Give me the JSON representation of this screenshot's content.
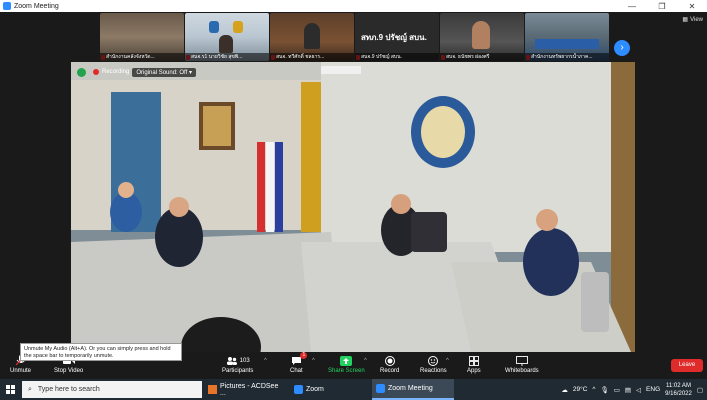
{
  "window": {
    "title": "Zoom Meeting",
    "view_label": "View"
  },
  "thumbnails": [
    {
      "label": "สำนักงานคลังจังหวัด..."
    },
    {
      "label": "สนจ.ร1 นายวิชัย สุขพิ..."
    },
    {
      "label": "สนจ. ทวีศักดิ์ ชลธาร..."
    },
    {
      "label": "สนจ.9 ปรัชญ์ สบน.",
      "big_name": "สทภ.9 ปรัชญ์ สบน."
    },
    {
      "label": "สบจ. ธนัชพร ผ่องศรี"
    },
    {
      "label": "สำนักงานทรัพยากรน้ำภาค..."
    }
  ],
  "recording": {
    "label": "Recording",
    "sound_label": "Original Sound: Off"
  },
  "tooltip": {
    "text": "Unmute My Audio (Alt+A). Or you can simply press and hold the space bar to temporarily unmute."
  },
  "toolbar": {
    "unmute_label": "Unmute",
    "stop_video_label": "Stop Video",
    "participants_label": "Participants",
    "participants_count": "103",
    "chat_label": "Chat",
    "chat_badge": "1",
    "share_label": "Share Screen",
    "record_label": "Record",
    "reactions_label": "Reactions",
    "apps_label": "Apps",
    "whiteboards_label": "Whiteboards",
    "leave_label": "Leave"
  },
  "taskbar": {
    "search_placeholder": "Type here to search",
    "tasks": [
      {
        "label": "Pictures - ACDSee ..."
      },
      {
        "label": "Zoom"
      },
      {
        "label": "Zoom Meeting"
      }
    ],
    "weather": "29°C",
    "language": "ENG",
    "time": "11:02 AM",
    "date": "9/16/2022"
  },
  "colors": {
    "accent": "#2d8cff",
    "leave": "#e02b2b",
    "share": "#23d160",
    "recording": "#e02b2b"
  }
}
